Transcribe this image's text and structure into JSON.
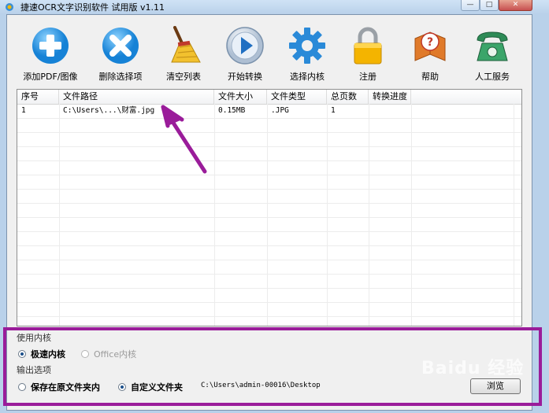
{
  "window": {
    "title": "捷速OCR文字识别软件 试用版 v1.11"
  },
  "toolbar": [
    {
      "label": "添加PDF/图像",
      "icon": "plus-circle-icon"
    },
    {
      "label": "删除选择项",
      "icon": "x-circle-icon"
    },
    {
      "label": "清空列表",
      "icon": "broom-icon"
    },
    {
      "label": "开始转换",
      "icon": "play-circle-icon"
    },
    {
      "label": "选择内核",
      "icon": "gear-icon"
    },
    {
      "label": "注册",
      "icon": "lock-icon"
    },
    {
      "label": "帮助",
      "icon": "help-book-icon"
    },
    {
      "label": "人工服务",
      "icon": "telephone-icon"
    }
  ],
  "table": {
    "columns": [
      "序号",
      "文件路径",
      "文件大小",
      "文件类型",
      "总页数",
      "转换进度"
    ],
    "rows": [
      [
        "1",
        "C:\\Users\\...\\财富.jpg",
        "0.15MB",
        ".JPG",
        "1",
        ""
      ]
    ]
  },
  "kernel": {
    "label": "使用内核",
    "options": [
      {
        "text": "极速内核",
        "selected": true,
        "disabled": false
      },
      {
        "text": "Office内核",
        "selected": false,
        "disabled": true
      }
    ]
  },
  "output": {
    "label": "输出选项",
    "options": [
      {
        "text": "保存在原文件夹内",
        "selected": false
      },
      {
        "text": "自定义文件夹",
        "selected": true
      }
    ],
    "path": "C:\\Users\\admin-00016\\Desktop",
    "browse_label": "浏览"
  },
  "colors": {
    "annotation": "#9a1c9a",
    "client_bg": "#f0f0f0",
    "frame": "#b9d1ea"
  }
}
